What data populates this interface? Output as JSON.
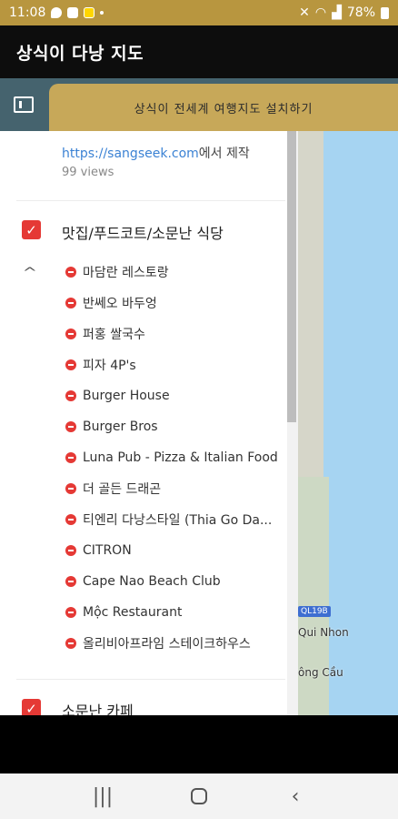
{
  "status_bar": {
    "time": "11:08",
    "battery": "78%"
  },
  "app_bar": {
    "title": "상식이 다낭 지도"
  },
  "toolbar": {
    "install_label": "상식이 전세계 여행지도 설치하기"
  },
  "sidebar": {
    "attribution_link": "https://sangseek.com",
    "attribution_suffix": "에서 제작",
    "views": "99 views",
    "groups": [
      {
        "title": "맛집/푸드코트/소문난 식당",
        "checked": true,
        "places": [
          "마담란 레스토랑",
          "반쎄오 바두엉",
          "퍼홍 쌀국수",
          "피자 4P's",
          "Burger House",
          "Burger Bros",
          "Luna Pub - Pizza & Italian Food",
          "더 골든 드래곤",
          "티엔리 다낭스타일 (Thia Go Da...",
          "CITRON",
          "Cape Nao Beach Club",
          "Mộc Restaurant",
          "올리비아프라임 스테이크하우스"
        ]
      },
      {
        "title": "소문난 카페",
        "checked": true
      }
    ]
  },
  "map": {
    "road_shield": "QL19B",
    "city_1": "Qui Nhon",
    "city_2": "ông Cầu",
    "colors": {
      "sea": "#a6d4f2",
      "land": "#d6d6c9"
    }
  },
  "colors": {
    "accent_gold": "#c7a859",
    "status_bar": "#b8963f",
    "toolbar": "#45636e",
    "checkbox": "#e53935",
    "link": "#3b82d4"
  }
}
